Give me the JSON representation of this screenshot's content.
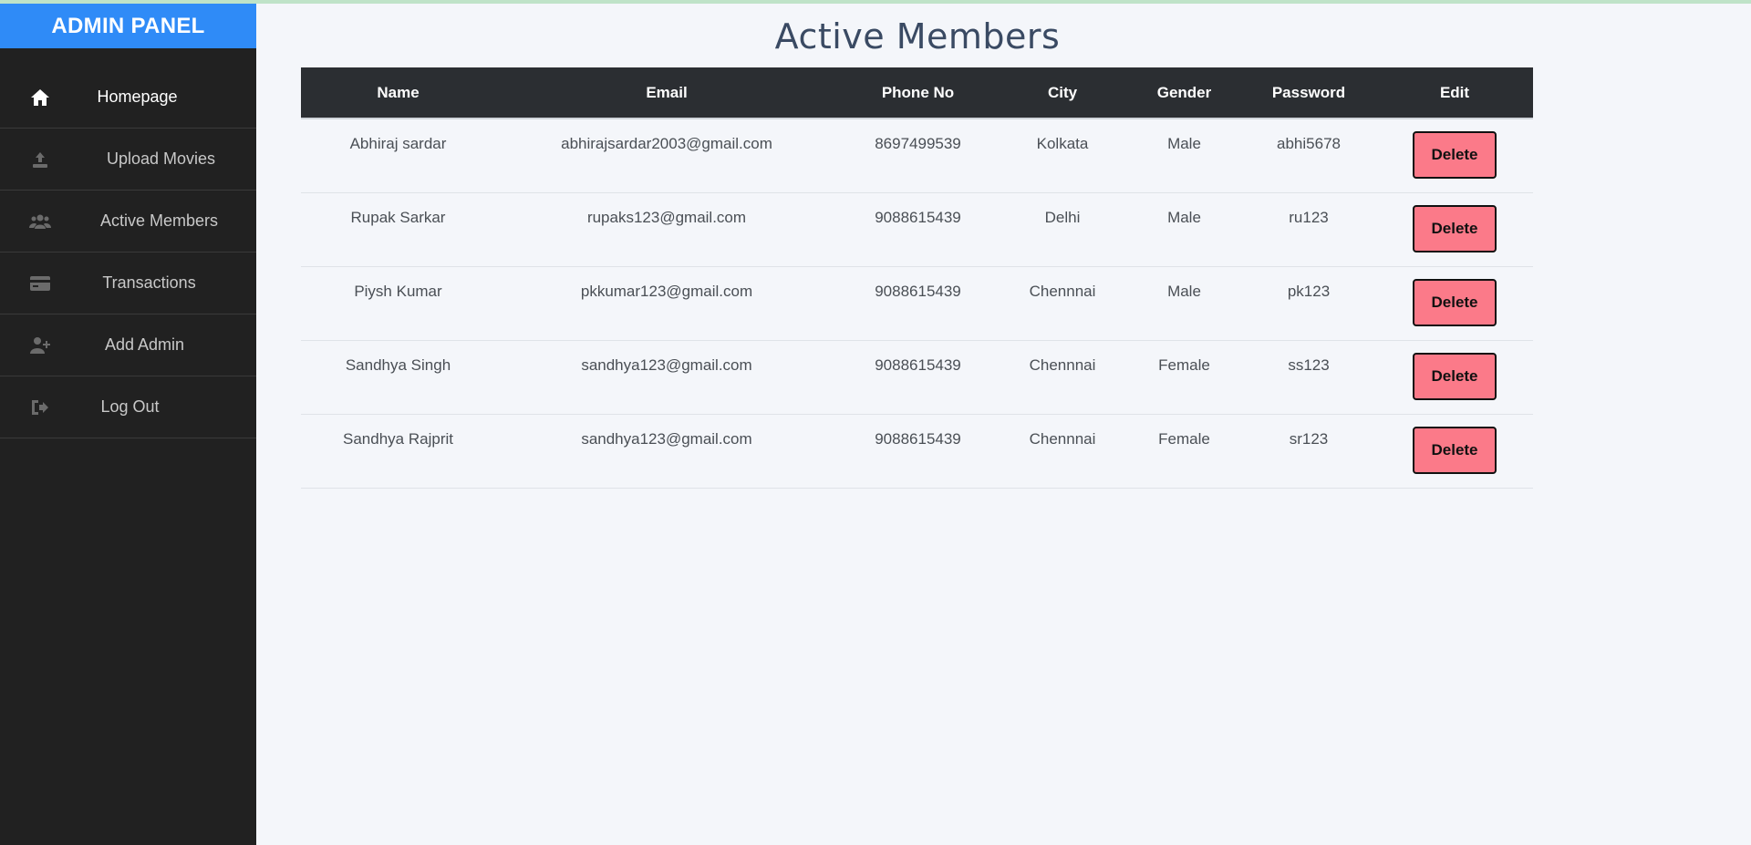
{
  "sidebar": {
    "brand": "ADMIN PANEL",
    "items": [
      {
        "label": "Homepage",
        "icon": "home-icon"
      },
      {
        "label": "Upload Movies",
        "icon": "upload-icon"
      },
      {
        "label": "Active Members",
        "icon": "users-icon"
      },
      {
        "label": "Transactions",
        "icon": "credit-card-icon"
      },
      {
        "label": "Add Admin",
        "icon": "user-plus-icon"
      },
      {
        "label": "Log Out",
        "icon": "logout-icon"
      }
    ]
  },
  "main": {
    "title": "Active Members",
    "table": {
      "headers": [
        "Name",
        "Email",
        "Phone No",
        "City",
        "Gender",
        "Password",
        "Edit"
      ],
      "rows": [
        {
          "name": "Abhiraj sardar",
          "email": "abhirajsardar2003@gmail.com",
          "phone": "8697499539",
          "city": "Kolkata",
          "gender": "Male",
          "password": "abhi5678",
          "action": "Delete"
        },
        {
          "name": "Rupak Sarkar",
          "email": "rupaks123@gmail.com",
          "phone": "9088615439",
          "city": "Delhi",
          "gender": "Male",
          "password": "ru123",
          "action": "Delete"
        },
        {
          "name": "Piysh Kumar",
          "email": "pkkumar123@gmail.com",
          "phone": "9088615439",
          "city": "Chennnai",
          "gender": "Male",
          "password": "pk123",
          "action": "Delete"
        },
        {
          "name": "Sandhya Singh",
          "email": "sandhya123@gmail.com",
          "phone": "9088615439",
          "city": "Chennnai",
          "gender": "Female",
          "password": "ss123",
          "action": "Delete"
        },
        {
          "name": "Sandhya Rajprit",
          "email": "sandhya123@gmail.com",
          "phone": "9088615439",
          "city": "Chennnai",
          "gender": "Female",
          "password": "sr123",
          "action": "Delete"
        }
      ]
    }
  },
  "colors": {
    "brand": "#2f8bf7",
    "sidebar": "#212121",
    "table_header": "#2b2e32",
    "delete_button": "#fb7a89"
  }
}
